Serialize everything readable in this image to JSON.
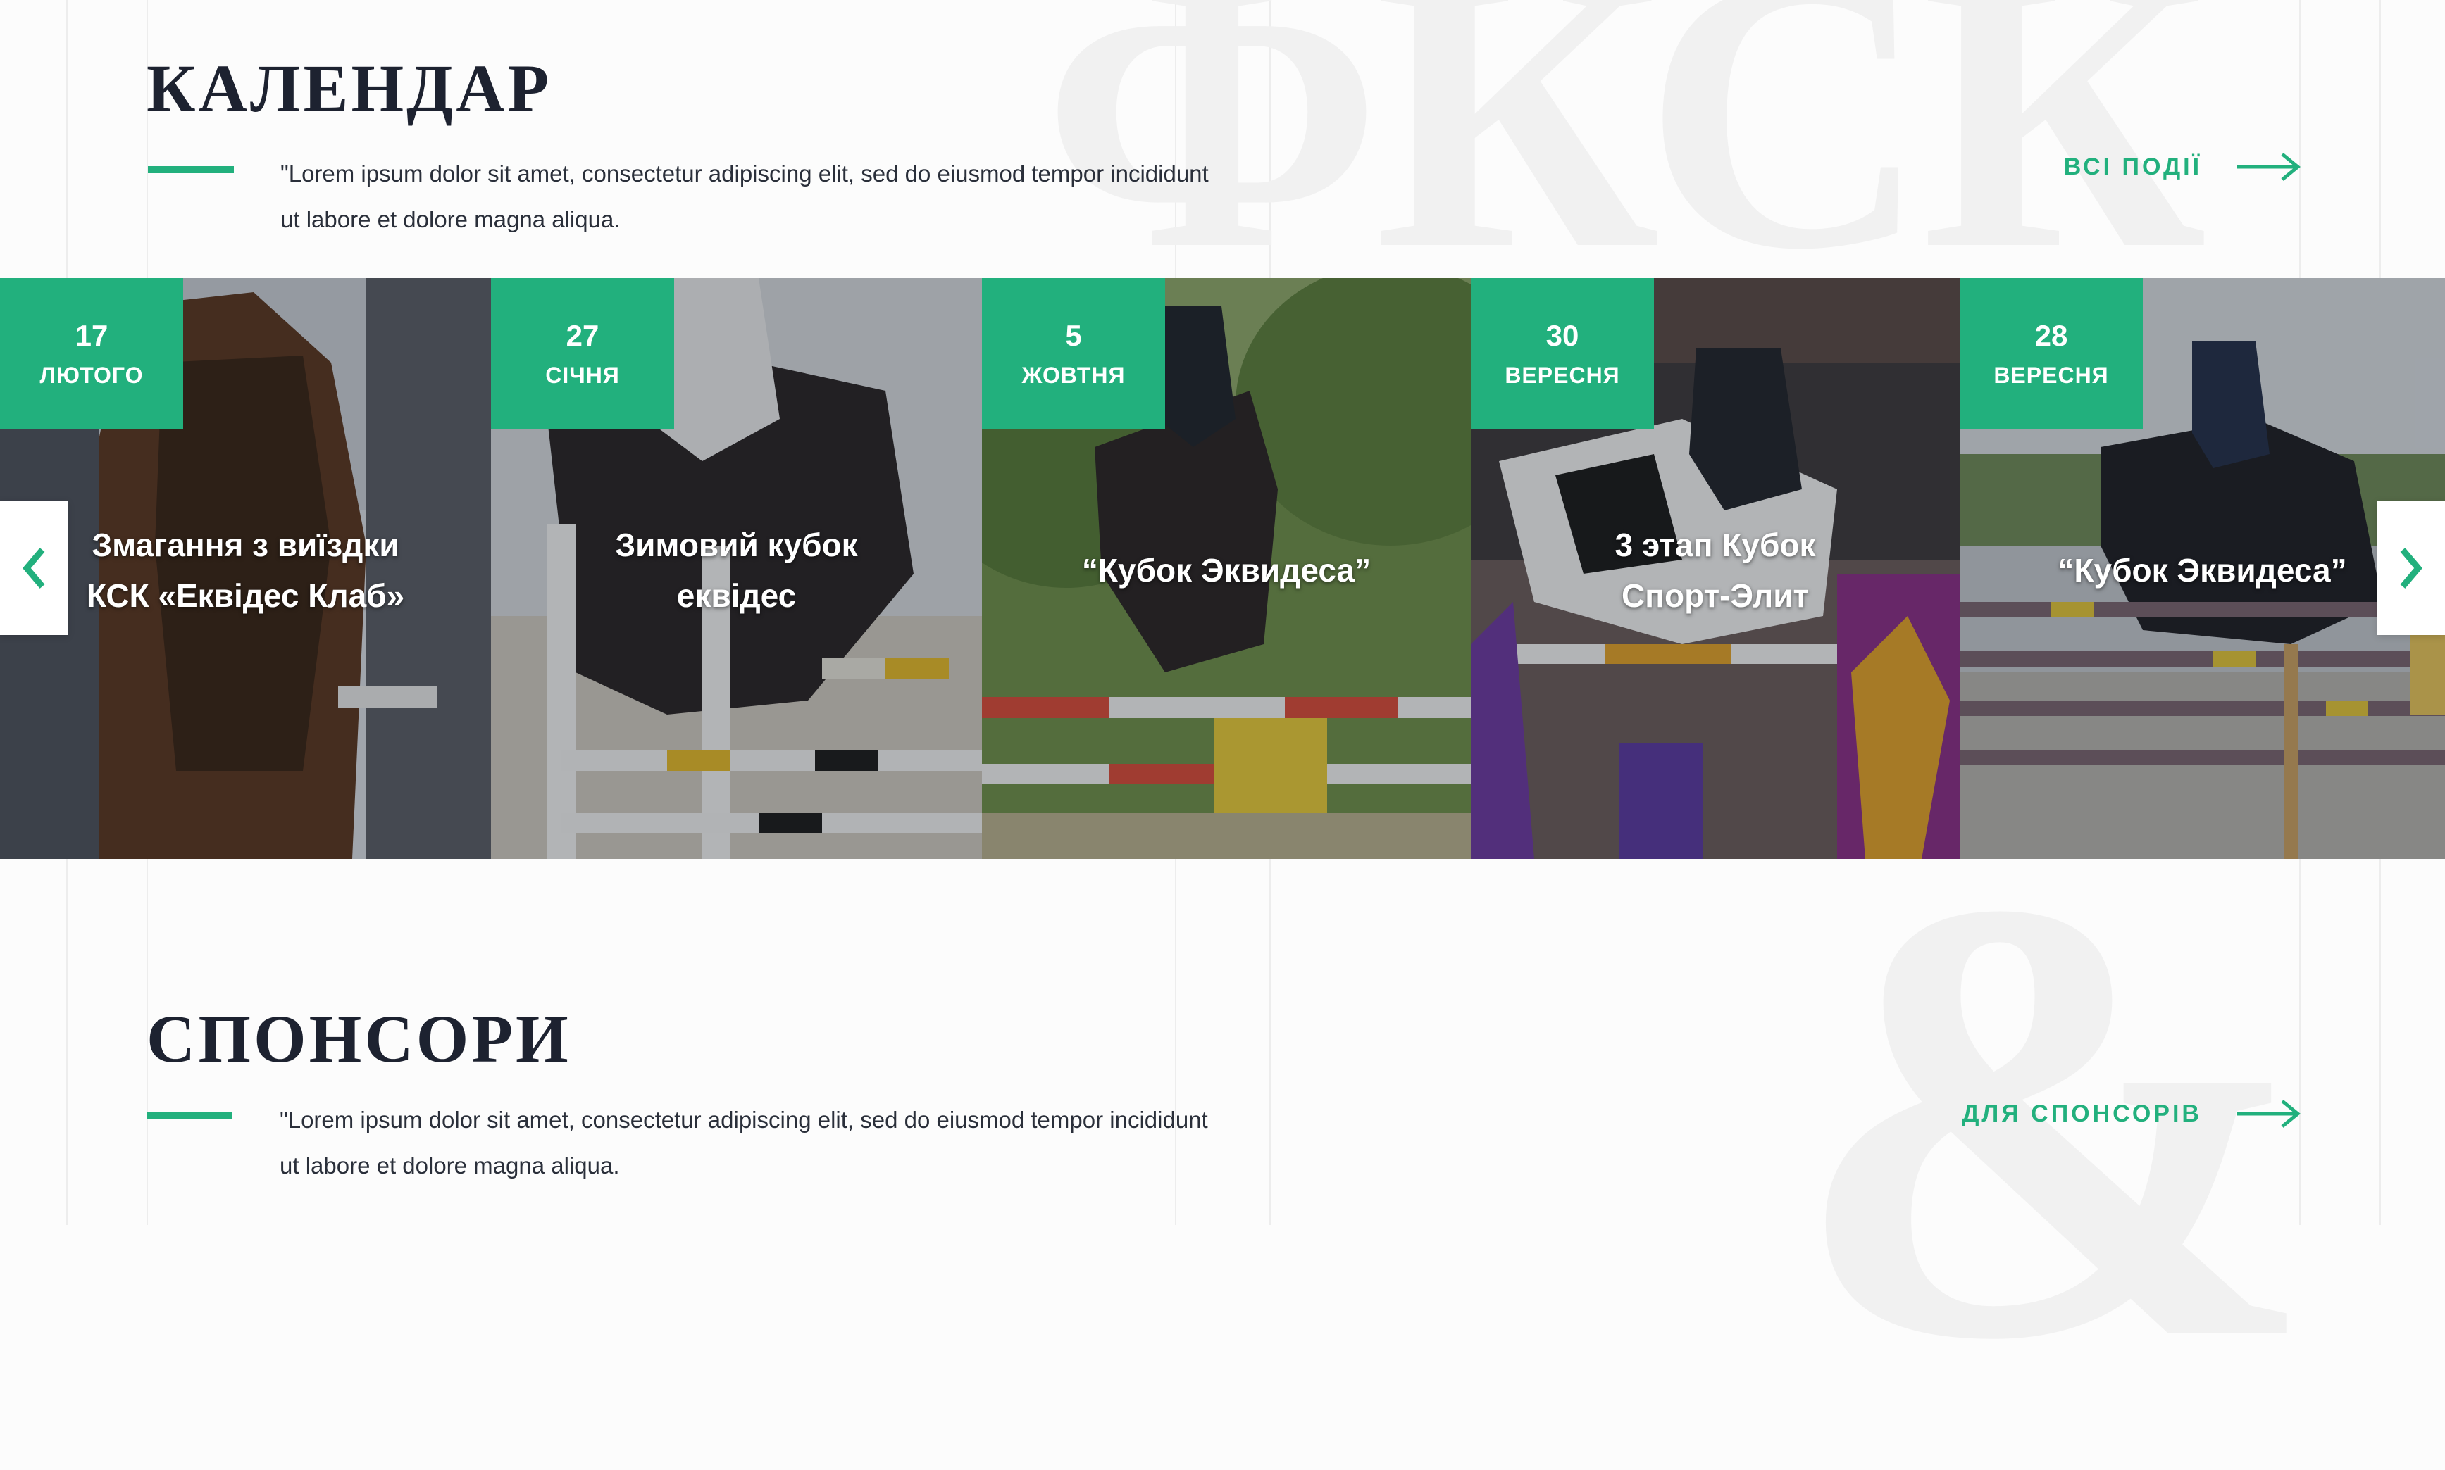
{
  "calendar": {
    "title": "КАЛЕНДАР",
    "description_line1": "\"Lorem ipsum dolor sit amet, consectetur adipiscing elit, sed do eiusmod tempor incididunt",
    "description_line2": "ut labore et dolore magna aliqua.",
    "link_label": "ВСІ ПОДІЇ",
    "watermark": "ФКСК"
  },
  "events": [
    {
      "day": "17",
      "month": "ЛЮТОГО",
      "title_line1": "Змагання з виїздки",
      "title_line2": "КСК «Еквідес Клаб»"
    },
    {
      "day": "27",
      "month": "СІЧНЯ",
      "title_line1": "Зимовий кубок",
      "title_line2": "еквідес"
    },
    {
      "day": "5",
      "month": "ЖОВТНЯ",
      "title_line1": "“Кубок Эквидеса”",
      "title_line2": ""
    },
    {
      "day": "30",
      "month": "ВЕРЕСНЯ",
      "title_line1": "3 этап Кубок",
      "title_line2": "Спорт-Элит"
    },
    {
      "day": "28",
      "month": "ВЕРЕСНЯ",
      "title_line1": "“Кубок Эквидеса”",
      "title_line2": ""
    }
  ],
  "sponsors": {
    "title": "СПОНСОРИ",
    "description_line1": "\"Lorem ipsum dolor sit amet, consectetur adipiscing elit, sed do eiusmod tempor incididunt",
    "description_line2": "ut labore et dolore magna aliqua.",
    "link_label": "ДЛЯ СПОНСОРІВ",
    "watermark": "&"
  },
  "icons": {
    "prev": "chevron-left-icon",
    "next": "chevron-right-icon",
    "link_arrow": "arrow-right-icon"
  },
  "colors": {
    "accent": "#22b07d",
    "heading": "#1d2230",
    "background": "#fcfcfc"
  }
}
